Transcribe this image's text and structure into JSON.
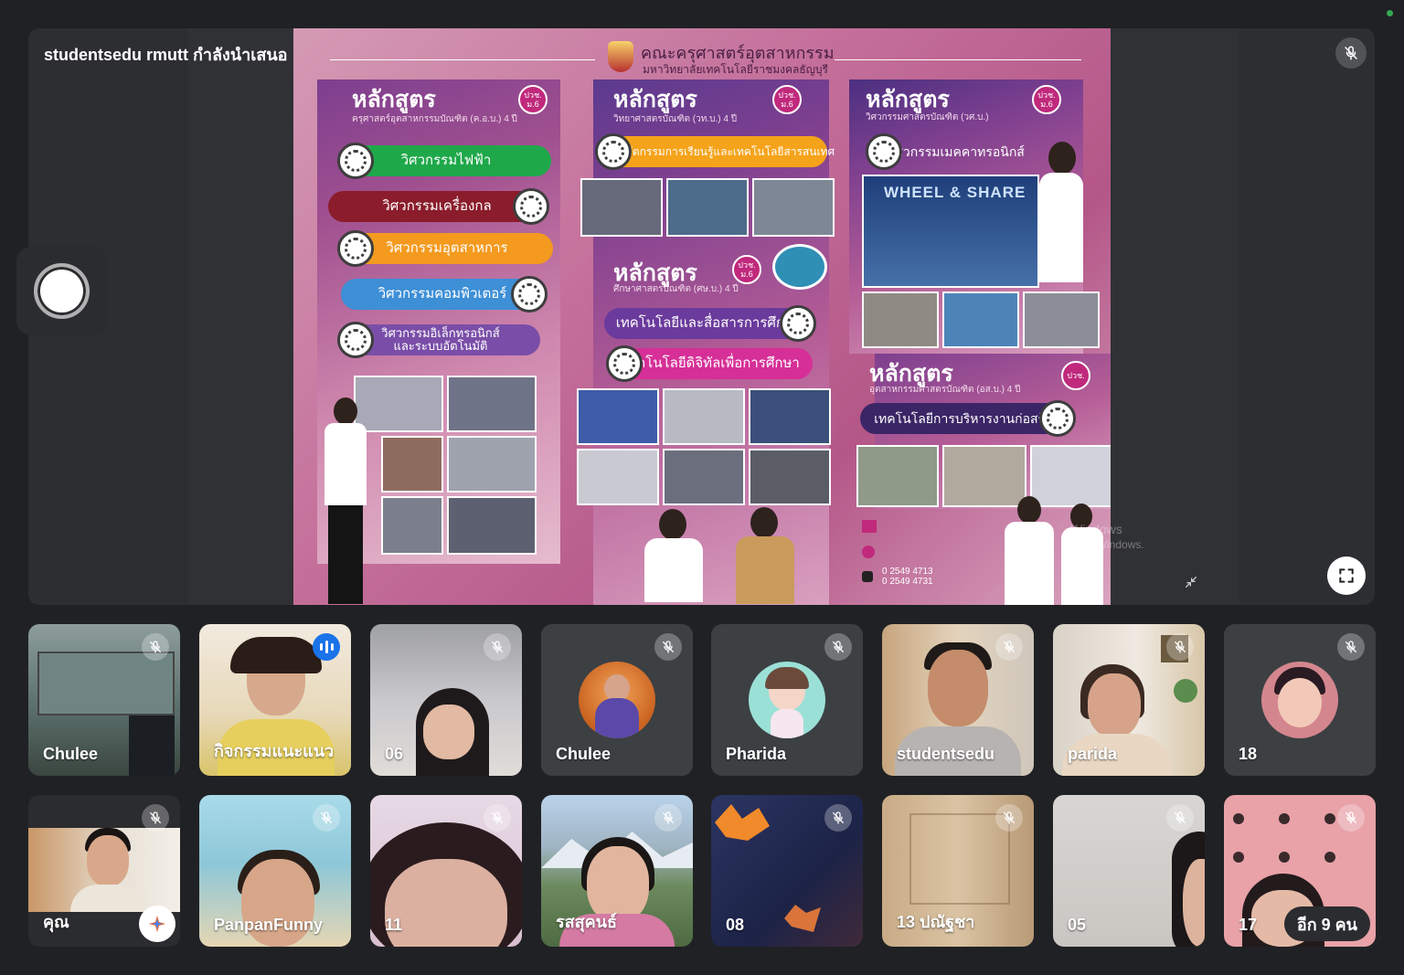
{
  "meeting": {
    "presenter_label": "studentsedu rmutt กำลังนำเสนอ"
  },
  "slide": {
    "title": "คณะครุศาสตร์อุตสาหกรรม",
    "subtitle": "มหาวิทยาลัยเทคโนโลยีราชมงคลธัญบุรี",
    "columns": [
      {
        "heading": "หลักสูตร",
        "degree": "ครุศาสตร์อุตสาหกรรมบัณฑิต (ค.อ.บ.) 4 ปี",
        "badge": "ปวช. ม.6",
        "programs": [
          "วิศวกรรมไฟฟ้า",
          "วิศวกรรมเครื่องกล",
          "วิศวกรรมอุตสาหการ",
          "วิศวกรรมคอมพิวเตอร์",
          "วิศวกรรมอิเล็กทรอนิกส์ และระบบอัตโนมัติ"
        ]
      },
      {
        "heading": "หลักสูตร",
        "degree": "วิทยาศาสตรบัณฑิต (วท.บ.) 4 ปี",
        "badge": "ปวช. ม.6",
        "programs": [
          "นวัตกรรมการเรียนรู้และเทคโนโลยีสารสนเทศ"
        ]
      },
      {
        "heading": "หลักสูตร",
        "degree": "ศึกษาศาสตรบัณฑิต (ศษ.บ.) 4 ปี",
        "badge": "ปวช. ม.6",
        "programs": [
          "เทคโนโลยีและสื่อสารการศึกษา",
          "เทคโนโลยีดิจิทัลเพื่อการศึกษา"
        ]
      },
      {
        "heading": "หลักสูตร",
        "degree": "วิศวกรรมศาสตรบัณฑิต (วศ.บ.)",
        "badge": "ปวช. ม.6",
        "programs": [
          "วิศวกรรมเมคคาทรอนิกส์"
        ]
      },
      {
        "heading": "หลักสูตร",
        "degree": "อุตสาหกรรมศาสตรบัณฑิต (อส.บ.) 4 ปี",
        "badge": "ปวช.",
        "programs": [
          "เทคโนโลยีการบริหารงานก่อสร้าง"
        ]
      }
    ],
    "banner_text": "WHEEL & SHARE",
    "phones": [
      "0 2549 4713",
      "0 2549 4731"
    ],
    "windows_watermark_1": "Windows",
    "windows_watermark_2": "ivate Windows."
  },
  "participants": [
    {
      "name": "Chulee",
      "muted": true
    },
    {
      "name": "กิจกรรมแนะแนว",
      "muted": false,
      "speaking": true
    },
    {
      "name": "06",
      "muted": true
    },
    {
      "name": "Chulee",
      "muted": true
    },
    {
      "name": "Pharida",
      "muted": true
    },
    {
      "name": "studentsedu",
      "muted": true
    },
    {
      "name": "parida",
      "muted": true
    },
    {
      "name": "18",
      "muted": true
    },
    {
      "name": "คุณ",
      "muted": true
    },
    {
      "name": "PanpanFunny",
      "muted": true
    },
    {
      "name": "11",
      "muted": true
    },
    {
      "name": "รสสุคนธ์",
      "muted": true
    },
    {
      "name": "08",
      "muted": true
    },
    {
      "name": "13 ปณัฐชา",
      "muted": true
    },
    {
      "name": "05",
      "muted": true
    },
    {
      "name": "17",
      "muted": true
    }
  ],
  "more_participants_label": "อีก 9 คน",
  "icons": {
    "mute": "mic-off-icon",
    "speaking": "audio-level-icon",
    "fullscreen": "fullscreen-icon",
    "minimize": "collapse-icon",
    "record": "record-icon",
    "effects": "sparkle-icon"
  },
  "colors": {
    "background": "#202124",
    "tile": "#3c4043",
    "speaking": "#1a73e8",
    "status": "#34a853"
  }
}
